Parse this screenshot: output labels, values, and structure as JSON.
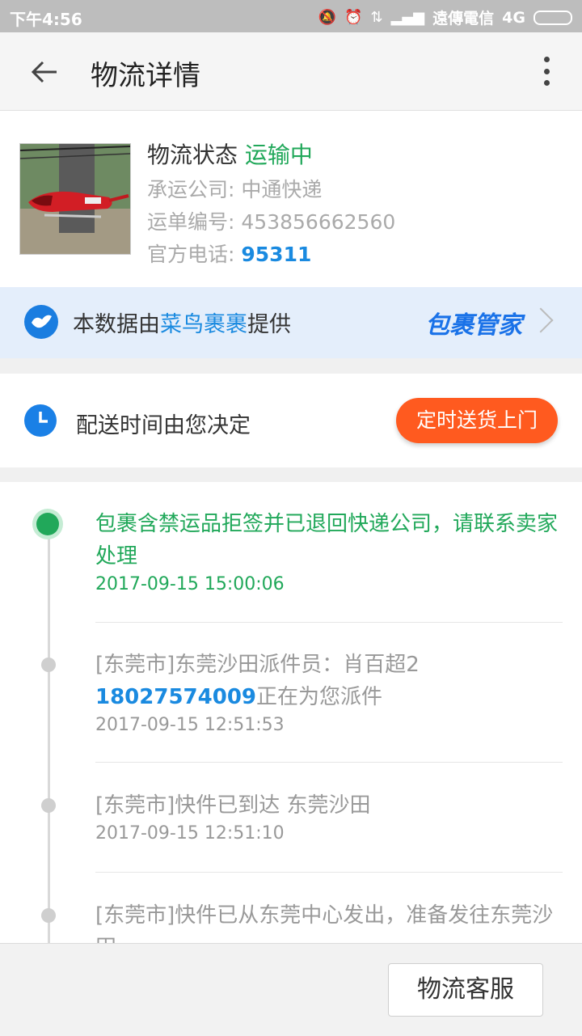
{
  "status_bar": {
    "time": "下午4:56",
    "carrier": "遠傳電信",
    "network": "4G"
  },
  "app_bar": {
    "title": "物流详情"
  },
  "shipment": {
    "status_label": "物流状态",
    "status_value": "运输中",
    "carrier_label": "承运公司:",
    "carrier_value": "中通快递",
    "tracking_label": "运单编号:",
    "tracking_value": "453856662560",
    "phone_label": "官方电话:",
    "phone_value": "95311"
  },
  "cainiao": {
    "prefix": "本数据由",
    "link": "菜鸟裹裹",
    "suffix": "提供",
    "brand": "包裹管家"
  },
  "delivery": {
    "label": "配送时间由您决定",
    "button": "定时送货上门"
  },
  "timeline": [
    {
      "text": "包裹含禁运品拒签并已退回快递公司，请联系卖家处理",
      "time": "2017-09-15 15:00:06"
    },
    {
      "text_prefix": "[东莞市]东莞沙田派件员：肖百超2",
      "phone": "18027574009",
      "text_suffix": "正在为您派件",
      "time": "2017-09-15 12:51:53"
    },
    {
      "text": "[东莞市]快件已到达 东莞沙田",
      "time": "2017-09-15 12:51:10"
    },
    {
      "text": "[东莞市]快件已从东莞中心发出，准备发往东莞沙田"
    }
  ],
  "bottom": {
    "service_button": "物流客服"
  },
  "colors": {
    "accent_green": "#21a85a",
    "link_blue": "#1a8ae0",
    "action_orange": "#ff5a1f"
  }
}
